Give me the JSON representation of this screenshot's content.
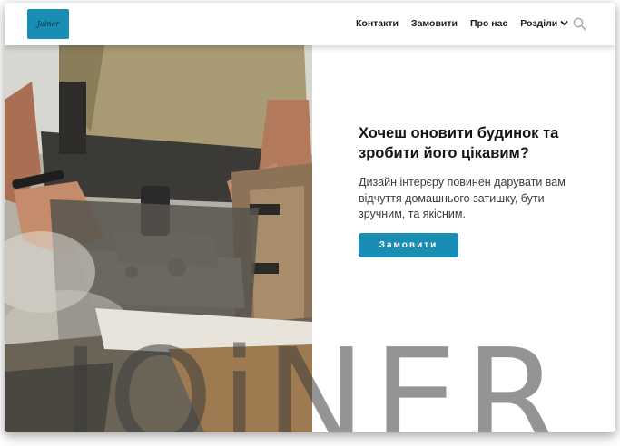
{
  "header": {
    "logo_text": "Joiner",
    "nav": [
      {
        "label": "Контакти"
      },
      {
        "label": "Замовити"
      },
      {
        "label": "Про нас"
      },
      {
        "label": "Розділи"
      }
    ]
  },
  "hero": {
    "headline": "Хочеш оновити будинок та зробити його цікавим?",
    "subtext": "Дизайн інтерєру повинен дарувати вам відчуття домашнього затишку, бути зручним, та якісним.",
    "cta_label": "Замовити",
    "watermark": "JOiNER"
  },
  "colors": {
    "accent": "#1a8db5"
  },
  "icons": [
    "chevron-down-icon",
    "search-icon"
  ]
}
